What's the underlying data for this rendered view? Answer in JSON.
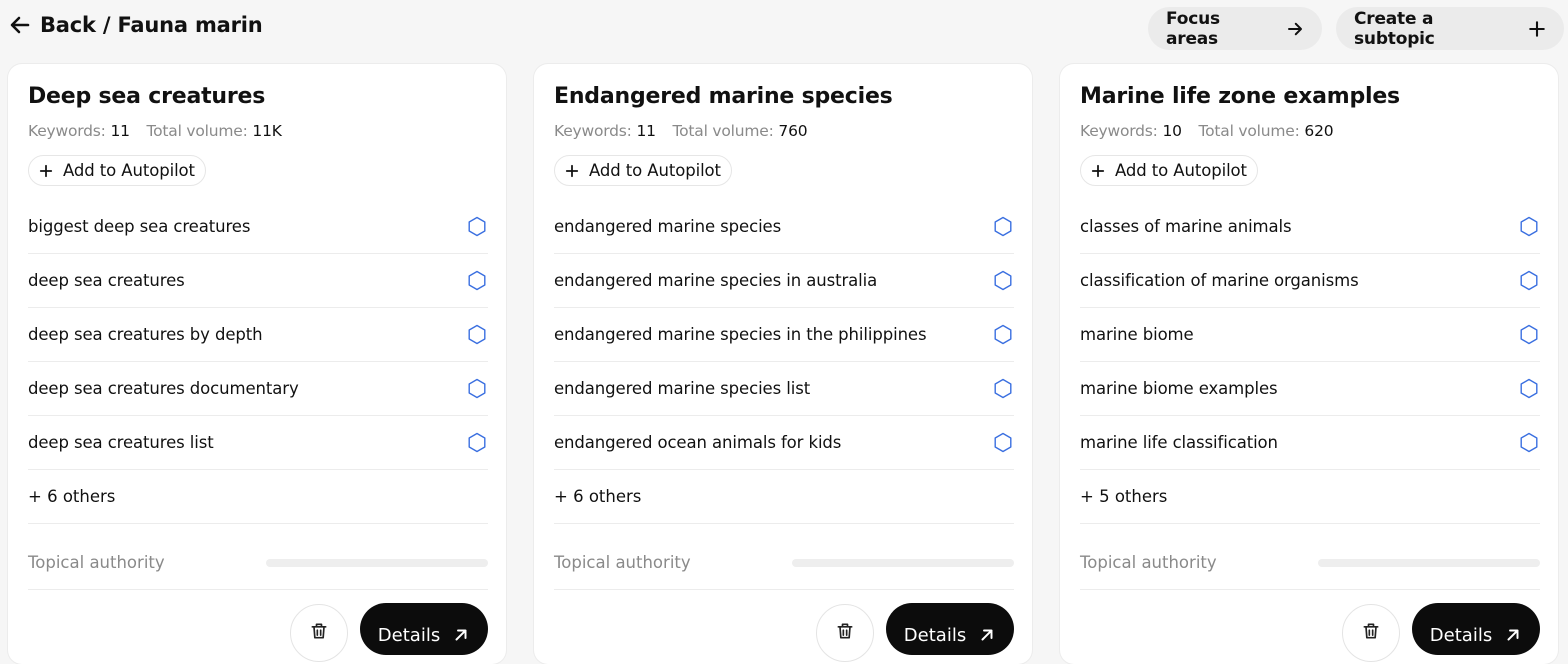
{
  "header": {
    "back_label": "Back / Fauna marin",
    "focus_areas_label": "Focus areas",
    "create_subtopic_label": "Create a subtopic"
  },
  "labels": {
    "keywords": "Keywords:",
    "total_volume": "Total volume:",
    "add_to_autopilot": "Add to Autopilot",
    "topical_authority": "Topical authority",
    "details": "Details"
  },
  "cards": [
    {
      "title": "Deep sea creatures",
      "keywords_count": "11",
      "total_volume": "11K",
      "keywords": [
        "biggest deep sea creatures",
        "deep sea creatures",
        "deep sea creatures by depth",
        "deep sea creatures documentary",
        "deep sea creatures list"
      ],
      "others": "+ 6 others",
      "topical_authority": 0
    },
    {
      "title": "Endangered marine species",
      "keywords_count": "11",
      "total_volume": "760",
      "keywords": [
        "endangered marine species",
        "endangered marine species in australia",
        "endangered marine species in the philippines",
        "endangered marine species list",
        "endangered ocean animals for kids"
      ],
      "others": "+ 6 others",
      "topical_authority": 0
    },
    {
      "title": "Marine life zone examples",
      "keywords_count": "10",
      "total_volume": "620",
      "keywords": [
        "classes of marine animals",
        "classification of marine organisms",
        "marine biome",
        "marine biome examples",
        "marine life classification"
      ],
      "others": "+ 5 others",
      "topical_authority": 0
    }
  ],
  "colors": {
    "hexagon_icon": "#3a6fe0",
    "details_button": "#0c0c0c",
    "muted_text": "#8a8a8a"
  },
  "icons": {
    "back": "arrow-left-icon",
    "focus_areas": "arrow-right-icon",
    "create_subtopic": "plus-icon",
    "add_to_autopilot": "plus-icon",
    "keyword_status": "hexagon-icon",
    "delete": "trash-icon",
    "details": "arrow-up-right-icon"
  }
}
